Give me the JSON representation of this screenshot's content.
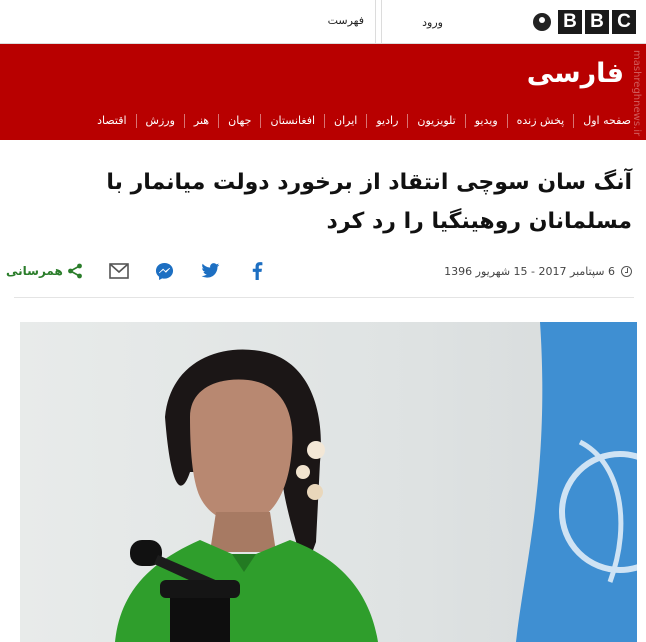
{
  "header": {
    "logo_letters": [
      "B",
      "B",
      "C"
    ],
    "signin_label": "ورود",
    "menu_label": "فهرست"
  },
  "banner": {
    "brand": "فارسی",
    "watermark": "mashreghnews.ir",
    "nav": [
      "صفحه اول",
      "پخش زنده",
      "ویدیو",
      "تلویزیون",
      "رادیو",
      "ایران",
      "افغانستان",
      "جهان",
      "هنر",
      "ورزش",
      "اقتصاد"
    ]
  },
  "article": {
    "headline": "آنگ سان سوچی انتقاد از برخورد دولت میانمار با مسلمانان روهینگیا را رد کرد",
    "date": "6 سپتامبر 2017 - 15 شهریور 1396",
    "share_label": "همرسانی"
  },
  "icons": {
    "share": "share-icon",
    "email": "email-icon",
    "messenger": "messenger-icon",
    "twitter": "twitter-icon",
    "facebook": "facebook-icon",
    "clock": "clock-icon",
    "user": "user-icon"
  },
  "colors": {
    "banner_red": "#b80000",
    "share_green": "#2a7d2a",
    "social_blue": "#1d6fc2",
    "photo_dress_green": "#2f9e2c",
    "flag_blue": "#3f8fd2"
  }
}
